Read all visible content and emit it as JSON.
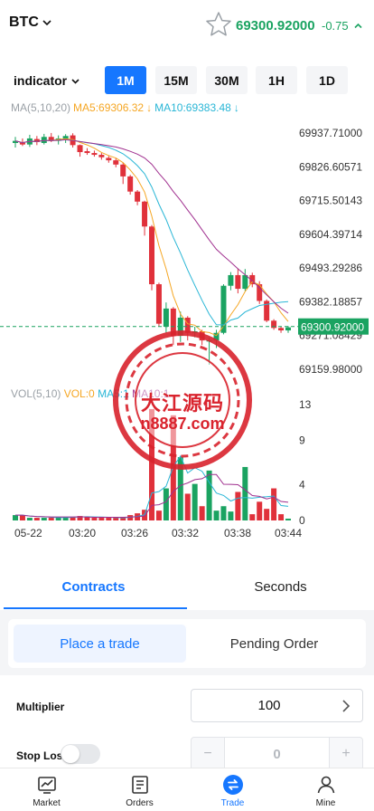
{
  "header": {
    "pair": "BTC",
    "price": "69300.92000",
    "change": "-0.75"
  },
  "toolbar": {
    "indicator_label": "indicator",
    "timeframes": [
      "1M",
      "15M",
      "30M",
      "1H",
      "1D"
    ],
    "active_timeframe": "1M"
  },
  "ma_legend": {
    "label": "MA(5,10,20)",
    "ma5": "MA5:69306.32",
    "ma10": "MA10:69383.48"
  },
  "vol_legend": {
    "label": "VOL(5,10)",
    "vol": "VOL:0",
    "ma5": "MA5:1",
    "ma10": "MA10:1"
  },
  "watermark": {
    "cn": "大江源码",
    "url": "n8887.com"
  },
  "colors": {
    "up": "#1aa361",
    "down": "#e0313b",
    "accent": "#1677ff",
    "ma5": "#f5a623",
    "ma10": "#29b6d6",
    "ma20": "#a0308f"
  },
  "chart_data": {
    "type": "candlestick",
    "price_axis": [
      "69937.71000",
      "69826.60571",
      "69715.50143",
      "69604.39714",
      "69493.29286",
      "69382.18857",
      "69271.08429",
      "69159.98000"
    ],
    "current_price": "69300.92000",
    "volume_axis": [
      "13",
      "9",
      "4",
      "0"
    ],
    "time_labels": [
      "05-22",
      "03:20",
      "03:26",
      "03:32",
      "03:38",
      "03:44"
    ],
    "candles": [
      {
        "o": 69905,
        "h": 69925,
        "l": 69890,
        "c": 69912
      },
      {
        "o": 69908,
        "h": 69920,
        "l": 69895,
        "c": 69900
      },
      {
        "o": 69900,
        "h": 69932,
        "l": 69892,
        "c": 69920
      },
      {
        "o": 69918,
        "h": 69928,
        "l": 69898,
        "c": 69908
      },
      {
        "o": 69905,
        "h": 69935,
        "l": 69900,
        "c": 69925
      },
      {
        "o": 69925,
        "h": 69938,
        "l": 69908,
        "c": 69912
      },
      {
        "o": 69912,
        "h": 69930,
        "l": 69900,
        "c": 69920
      },
      {
        "o": 69918,
        "h": 69934,
        "l": 69905,
        "c": 69928
      },
      {
        "o": 69930,
        "h": 69937,
        "l": 69890,
        "c": 69898
      },
      {
        "o": 69898,
        "h": 69900,
        "l": 69860,
        "c": 69875
      },
      {
        "o": 69878,
        "h": 69888,
        "l": 69866,
        "c": 69872
      },
      {
        "o": 69872,
        "h": 69880,
        "l": 69860,
        "c": 69866
      },
      {
        "o": 69866,
        "h": 69872,
        "l": 69850,
        "c": 69858
      },
      {
        "o": 69856,
        "h": 69862,
        "l": 69840,
        "c": 69848
      },
      {
        "o": 69848,
        "h": 69854,
        "l": 69825,
        "c": 69834
      },
      {
        "o": 69834,
        "h": 69840,
        "l": 69770,
        "c": 69795
      },
      {
        "o": 69795,
        "h": 69800,
        "l": 69735,
        "c": 69745
      },
      {
        "o": 69745,
        "h": 69750,
        "l": 69700,
        "c": 69712
      },
      {
        "o": 69712,
        "h": 69715,
        "l": 69600,
        "c": 69630
      },
      {
        "o": 69630,
        "h": 69635,
        "l": 69420,
        "c": 69440
      },
      {
        "o": 69440,
        "h": 69445,
        "l": 69300,
        "c": 69310
      },
      {
        "o": 69300,
        "h": 69380,
        "l": 69280,
        "c": 69360
      },
      {
        "o": 69360,
        "h": 69365,
        "l": 69240,
        "c": 69270
      },
      {
        "o": 69270,
        "h": 69350,
        "l": 69250,
        "c": 69330
      },
      {
        "o": 69330,
        "h": 69335,
        "l": 69255,
        "c": 69280
      },
      {
        "o": 69280,
        "h": 69300,
        "l": 69265,
        "c": 69285
      },
      {
        "o": 69285,
        "h": 69290,
        "l": 69240,
        "c": 69255
      },
      {
        "o": 69255,
        "h": 69265,
        "l": 69175,
        "c": 69255
      },
      {
        "o": 69255,
        "h": 69290,
        "l": 69230,
        "c": 69280
      },
      {
        "o": 69280,
        "h": 69440,
        "l": 69275,
        "c": 69435
      },
      {
        "o": 69435,
        "h": 69480,
        "l": 69420,
        "c": 69470
      },
      {
        "o": 69470,
        "h": 69492,
        "l": 69410,
        "c": 69425
      },
      {
        "o": 69425,
        "h": 69490,
        "l": 69418,
        "c": 69470
      },
      {
        "o": 69470,
        "h": 69478,
        "l": 69430,
        "c": 69440
      },
      {
        "o": 69440,
        "h": 69450,
        "l": 69375,
        "c": 69385
      },
      {
        "o": 69385,
        "h": 69390,
        "l": 69315,
        "c": 69320
      },
      {
        "o": 69320,
        "h": 69325,
        "l": 69290,
        "c": 69296
      },
      {
        "o": 69296,
        "h": 69300,
        "l": 69280,
        "c": 69288
      },
      {
        "o": 69288,
        "h": 69302,
        "l": 69280,
        "c": 69298
      }
    ],
    "volumes": [
      0.6,
      0.6,
      0.3,
      0.3,
      0.3,
      0.3,
      0.4,
      0.4,
      0.4,
      0.5,
      0.4,
      0.3,
      0.3,
      0.3,
      0.3,
      0.3,
      0.6,
      0.8,
      1.2,
      12.5,
      1.1,
      3.6,
      11.8,
      7.1,
      3.0,
      4.1,
      1.6,
      5.6,
      1.1,
      1.6,
      1.0,
      3.2,
      6.0,
      0.7,
      2.1,
      1.3,
      3.6,
      0.7,
      0.2
    ]
  },
  "lower": {
    "tabs": [
      "Contracts",
      "Seconds"
    ],
    "active_tab": "Contracts",
    "segments": [
      "Place a trade",
      "Pending Order"
    ],
    "active_segment": "Place a trade",
    "multiplier_label": "Multiplier",
    "multiplier_value": "100",
    "stop_loss_label": "Stop Loss",
    "stop_loss_value": "0",
    "minus": "−",
    "plus": "+"
  },
  "nav": [
    {
      "label": "Market",
      "icon": "market-icon"
    },
    {
      "label": "Orders",
      "icon": "orders-icon"
    },
    {
      "label": "Trade",
      "icon": "trade-icon"
    },
    {
      "label": "Mine",
      "icon": "mine-icon"
    }
  ],
  "active_nav": "Trade"
}
